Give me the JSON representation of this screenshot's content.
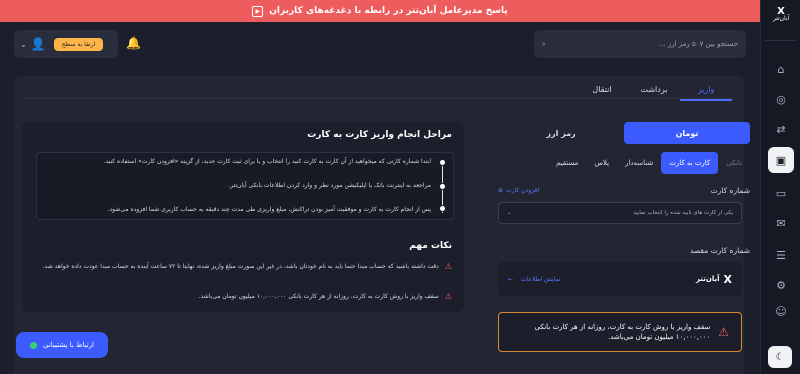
{
  "banner": {
    "text": "پاسخ مدیرعامل آبان‌تتر در رابطه با دغدغه‌های کاربران"
  },
  "brand": {
    "name": "آبان‌تتر",
    "logo": "X"
  },
  "header": {
    "search_placeholder": "جستجو بین ۵۰۷ رمز ارز ...",
    "upgrade_label": "ارتقا به سطح",
    "icons": [
      "search-icon",
      "bell-icon",
      "user-icon",
      "chevron-down-icon"
    ]
  },
  "tabs": [
    {
      "label": "واریز"
    },
    {
      "label": "برداشت"
    },
    {
      "label": "انتقال"
    }
  ],
  "steps": {
    "title": "مراحل انجام واریز کارت به کارت",
    "items": [
      "ابتدا شماره کارتی که میخواهید از آن کارت به کارت کنید را انتخاب و یا برای ثبت کارت جدید، از گزینه «افزودن کارت» استفاده کنید.",
      "مراجعه به اینترنت بانک یا اپلیکیشن مورد نظر و وارد کردن اطلاعات بانکی آبان‌تتر.",
      "پس از انجام کارت به کارت و موفقیت آمیز بودن تراکنش، مبلغ واریزی طی مدت چند دقیقه به حساب کاربری شما افزوده می‌شود."
    ]
  },
  "notes": {
    "title": "نکات مهم",
    "items": [
      "دقت داشته باشید که حساب مبدا حتما باید به نام خودتان باشد، در غیر این صورت مبلغ واریز شده، نهایتا تا ۷۲ ساعت آینده به حساب مبدا عودت داده خواهد شد.",
      "سقف واریز با روش کارت به کارت، روزانه از هر کارت بانکی ۱۰,۰۰۰,۰۰۰ میلیون تومان می‌باشد."
    ]
  },
  "support": {
    "label": "ارتباط با پشتیبانی"
  },
  "currency": {
    "options": [
      "تومان",
      "رمز ارز"
    ],
    "selected": "تومان"
  },
  "methods": {
    "options": [
      "بانکی",
      "کارت به کارت",
      "شناسه‌دار",
      "پلاس",
      "مستقیم"
    ],
    "selected": "کارت به کارت"
  },
  "card": {
    "label": "شماره کارت",
    "add_label": "افزودن کارت",
    "placeholder": "یکی از کارت های تایید شده را انتخاب نمایید"
  },
  "destination": {
    "label": "شماره کارت مقصد",
    "name": "آبان‌تتر",
    "show_info": "نمایش اطلاعات"
  },
  "limit": {
    "text": "سقف واریز با روش کارت به کارت، روزانه از هر کارت بانکی ۱۰,۰۰۰,۰۰۰ میلیون تومان می‌باشد."
  },
  "sidebar": {
    "icons": [
      "home-icon",
      "coins-icon",
      "exchange-icon",
      "wallet-icon",
      "card-icon",
      "gift-icon",
      "history-icon",
      "settings-icon",
      "user-icon",
      "moon-icon"
    ],
    "active": "wallet-icon"
  },
  "colors": {
    "accent": "#3b5bff",
    "danger": "#ee5d5d",
    "warning": "#d98a2b"
  }
}
